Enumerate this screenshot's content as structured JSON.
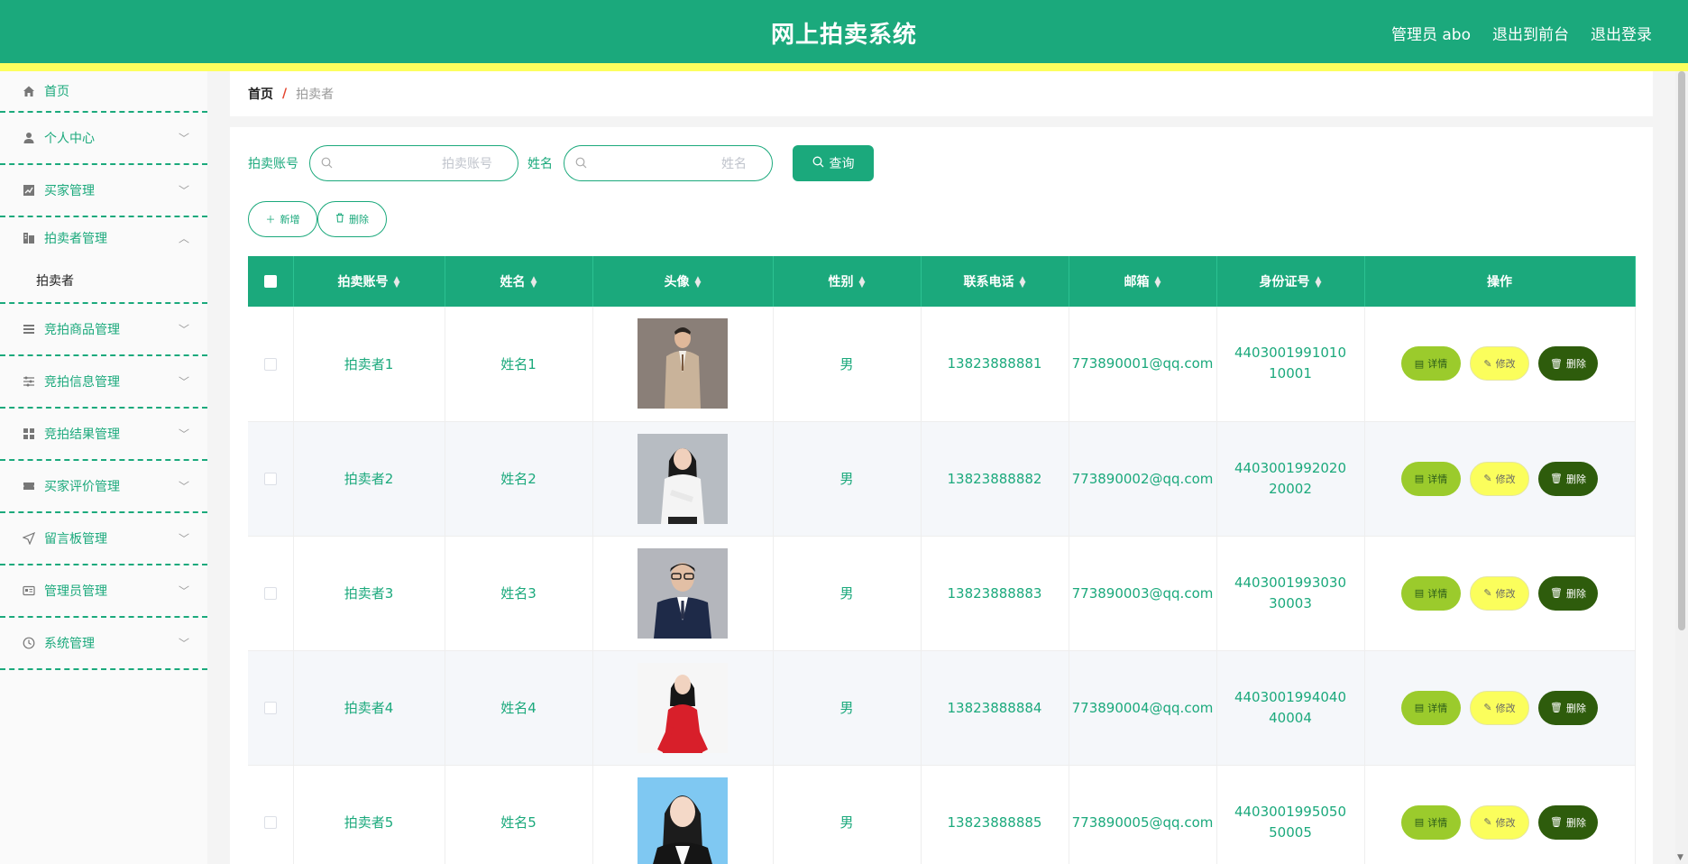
{
  "header": {
    "title": "网上拍卖系统",
    "admin_label": "管理员 abo",
    "to_front": "退出到前台",
    "logout": "退出登录"
  },
  "sidebar": {
    "items": [
      {
        "label": "首页",
        "icon": "home-icon"
      },
      {
        "label": "个人中心",
        "icon": "user-icon"
      },
      {
        "label": "买家管理",
        "icon": "chart-icon"
      },
      {
        "label": "拍卖者管理",
        "icon": "building-icon"
      },
      {
        "label": "竞拍商品管理",
        "icon": "list-icon"
      },
      {
        "label": "竞拍信息管理",
        "icon": "sliders-icon"
      },
      {
        "label": "竞拍结果管理",
        "icon": "grid-icon"
      },
      {
        "label": "买家评价管理",
        "icon": "ticket-icon"
      },
      {
        "label": "留言板管理",
        "icon": "send-icon"
      },
      {
        "label": "管理员管理",
        "icon": "id-card-icon"
      },
      {
        "label": "系统管理",
        "icon": "clock-icon"
      }
    ],
    "sub_item": "拍卖者"
  },
  "breadcrumb": {
    "home": "首页",
    "separator": "/",
    "current": "拍卖者"
  },
  "search": {
    "account_label": "拍卖账号",
    "account_placeholder": "拍卖账号",
    "name_label": "姓名",
    "name_placeholder": "姓名",
    "query_button": "查询"
  },
  "actions": {
    "add": "新增",
    "delete": "删除"
  },
  "table": {
    "columns": [
      "拍卖账号",
      "姓名",
      "头像",
      "性别",
      "联系电话",
      "邮箱",
      "身份证号",
      "操作"
    ],
    "op_labels": {
      "detail": "详情",
      "edit": "修改",
      "delete": "删除"
    },
    "rows": [
      {
        "account": "拍卖者1",
        "name": "姓名1",
        "gender": "男",
        "phone": "13823888881",
        "email": "773890001@qq.com",
        "id_number": "440300199101010001"
      },
      {
        "account": "拍卖者2",
        "name": "姓名2",
        "gender": "男",
        "phone": "13823888882",
        "email": "773890002@qq.com",
        "id_number": "440300199202020002"
      },
      {
        "account": "拍卖者3",
        "name": "姓名3",
        "gender": "男",
        "phone": "13823888883",
        "email": "773890003@qq.com",
        "id_number": "440300199303030003"
      },
      {
        "account": "拍卖者4",
        "name": "姓名4",
        "gender": "男",
        "phone": "13823888884",
        "email": "773890004@qq.com",
        "id_number": "440300199404040004"
      },
      {
        "account": "拍卖者5",
        "name": "姓名5",
        "gender": "男",
        "phone": "13823888885",
        "email": "773890005@qq.com",
        "id_number": "440300199505050005"
      }
    ]
  },
  "colors": {
    "primary": "#1ba97c",
    "header_stripe": "#fdff5e",
    "detail_button": "#9bcb2c",
    "edit_button": "#fbfe5c",
    "delete_button": "#2e5c0c"
  }
}
